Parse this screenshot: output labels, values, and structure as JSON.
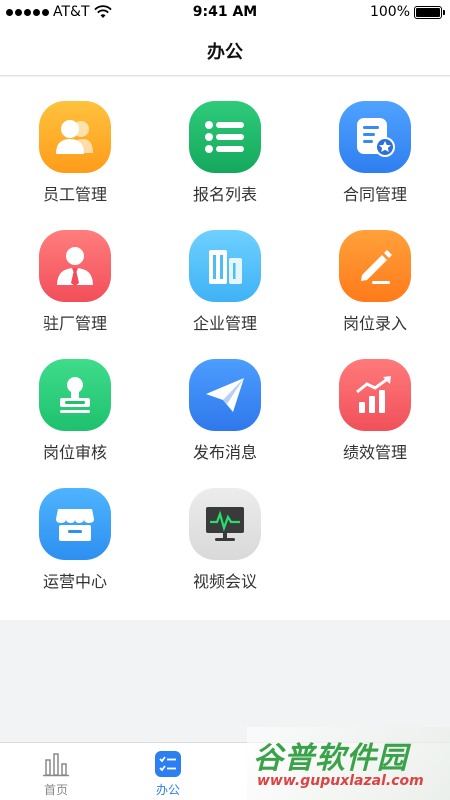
{
  "status": {
    "carrier": "AT&T",
    "time": "9:41 AM",
    "battery": "100%",
    "battery_level": 1.0
  },
  "nav": {
    "title": "办公"
  },
  "grid": [
    {
      "label": "员工管理",
      "icon": "staff-icon",
      "color_top": "#ffc23d",
      "color_bottom": "#ff9c1a"
    },
    {
      "label": "报名列表",
      "icon": "list-icon",
      "color_top": "#2ecb7b",
      "color_bottom": "#15a85c"
    },
    {
      "label": "合同管理",
      "icon": "contract-icon",
      "color_top": "#4fa3ff",
      "color_bottom": "#2f7ef0"
    },
    {
      "label": "驻厂管理",
      "icon": "manager-icon",
      "color_top": "#ff7d7d",
      "color_bottom": "#f24e5a"
    },
    {
      "label": "企业管理",
      "icon": "building-icon",
      "color_top": "#6ed0ff",
      "color_bottom": "#3fb2f5"
    },
    {
      "label": "岗位录入",
      "icon": "pencil-icon",
      "color_top": "#ffa13a",
      "color_bottom": "#ff7a1a"
    },
    {
      "label": "岗位审核",
      "icon": "stamp-icon",
      "color_top": "#3fdc8a",
      "color_bottom": "#1ec16f"
    },
    {
      "label": "发布消息",
      "icon": "paper-plane-icon",
      "color_top": "#4c9dff",
      "color_bottom": "#2f78ec"
    },
    {
      "label": "绩效管理",
      "icon": "growth-chart-icon",
      "color_top": "#ff7a7a",
      "color_bottom": "#f0505a"
    },
    {
      "label": "运营中心",
      "icon": "store-icon",
      "color_top": "#4fb4ff",
      "color_bottom": "#2d8ff0"
    },
    {
      "label": "视频会议",
      "icon": "monitor-icon",
      "color_top": "#ececec",
      "color_bottom": "#d9d9d9"
    }
  ],
  "tabs": [
    {
      "label": "首页",
      "icon": "home-bars-icon",
      "active": false
    },
    {
      "label": "办公",
      "icon": "office-checklist-icon",
      "active": true
    }
  ],
  "watermark": {
    "title": "谷普软件园",
    "url": "www.gupuxlazal.com"
  },
  "colors": {
    "accent": "#2b7ff0",
    "background": "#f2f3f5",
    "watermark_green": "#3aa34a",
    "watermark_red": "#d94444"
  }
}
